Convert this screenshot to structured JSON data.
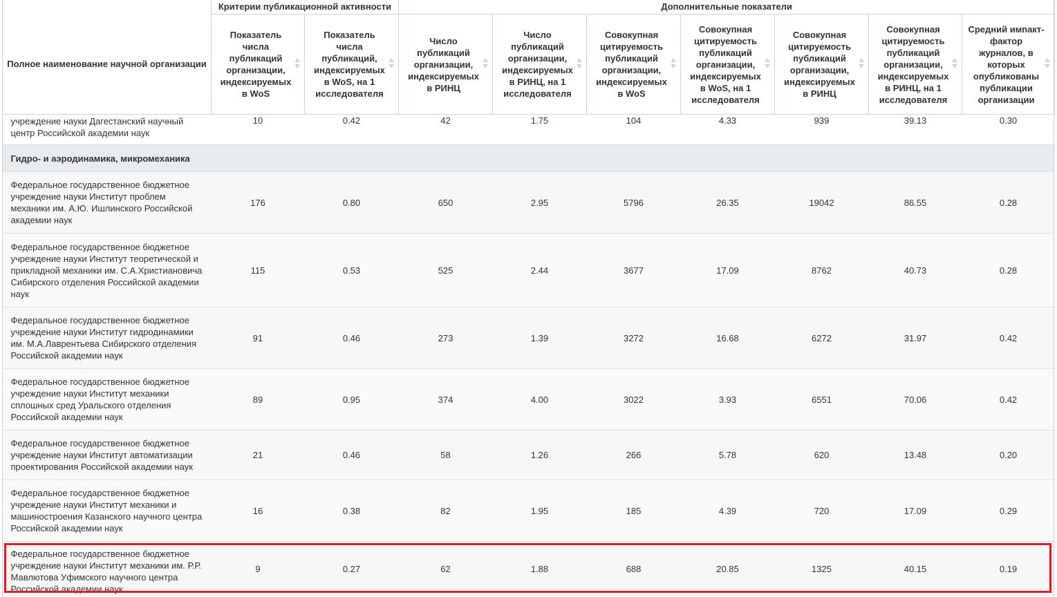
{
  "group_headers": {
    "left": "Критерии публикационной активности",
    "right": "Дополнительные показатели"
  },
  "columns": [
    "Полное наименование научной организации",
    "Показатель числа публикаций организации, индексируемых в WoS",
    "Показатель числа публикаций, индексируемых в WoS, на 1 исследователя",
    "Число публикаций организации, индексируемых в РИНЦ",
    "Число публикаций организации, индексируемых в РИНЦ, на 1 исследователя",
    "Совокупная цитируемость публикаций организации, индексируемых в WoS",
    "Совокупная цитируемость публикаций организации, индексируемых в WoS, на 1 исследователя",
    "Совокупная цитируемость публикаций организации, индексируемых в РИНЦ",
    "Совокупная цитируемость публикаций организации, индексируемых в РИНЦ, на 1 исследователя",
    "Средний импакт-фактор журналов, в которых опубликованы публикации организации"
  ],
  "partial_row": {
    "name": "учреждение науки Дагестанский научный центр Российской академии наук",
    "values": [
      "10",
      "0.42",
      "42",
      "1.75",
      "104",
      "4.33",
      "939",
      "39.13",
      "0.30"
    ]
  },
  "section": "Гидро- и аэродинамика, микромеханика",
  "rows": [
    {
      "name": "Федеральное государственное бюджетное учреждение науки Институт проблем механики им. А.Ю. Ишлинского Российской академии наук",
      "values": [
        "176",
        "0.80",
        "650",
        "2.95",
        "5796",
        "26.35",
        "19042",
        "86.55",
        "0.28"
      ]
    },
    {
      "name": "Федеральное государственное бюджетное учреждение науки Институт теоретической и прикладной механики им. С.А.Христиановича Сибирского отделения Российской академии наук",
      "values": [
        "115",
        "0.53",
        "525",
        "2.44",
        "3677",
        "17.09",
        "8762",
        "40.73",
        "0.28"
      ]
    },
    {
      "name": "Федеральное государственное бюджетное учреждение науки Институт гидродинамики им. М.А.Лаврентьева Сибирского отделения Российской академии наук",
      "values": [
        "91",
        "0.46",
        "273",
        "1.39",
        "3272",
        "16.68",
        "6272",
        "31.97",
        "0.42"
      ]
    },
    {
      "name": "Федеральное государственное бюджетное учреждение науки Институт механики сплошных сред Уральского отделения Российской академии наук",
      "values": [
        "89",
        "0.95",
        "374",
        "4.00",
        "3022",
        "3.93",
        "6551",
        "70.06",
        "0.42"
      ]
    },
    {
      "name": "Федеральное государственное бюджетное учреждение науки Институт автоматизации проектирования Российской академии наук",
      "values": [
        "21",
        "0.46",
        "58",
        "1.26",
        "266",
        "5.78",
        "620",
        "13.48",
        "0.20"
      ]
    },
    {
      "name": "Федеральное государственное бюджетное учреждение науки Институт механики и машиностроения Казанского научного центра Российской академии наук",
      "values": [
        "16",
        "0.38",
        "82",
        "1.95",
        "185",
        "4.39",
        "720",
        "17.09",
        "0.29"
      ]
    },
    {
      "name": "Федеральное государственное бюджетное учреждение науки Институт механики им. Р.Р. Мавлютова Уфимского научного центра Российской академии наук",
      "values": [
        "9",
        "0.27",
        "62",
        "1.88",
        "688",
        "20.85",
        "1325",
        "40.15",
        "0.19"
      ]
    }
  ],
  "highlight_color": "#d7202c"
}
